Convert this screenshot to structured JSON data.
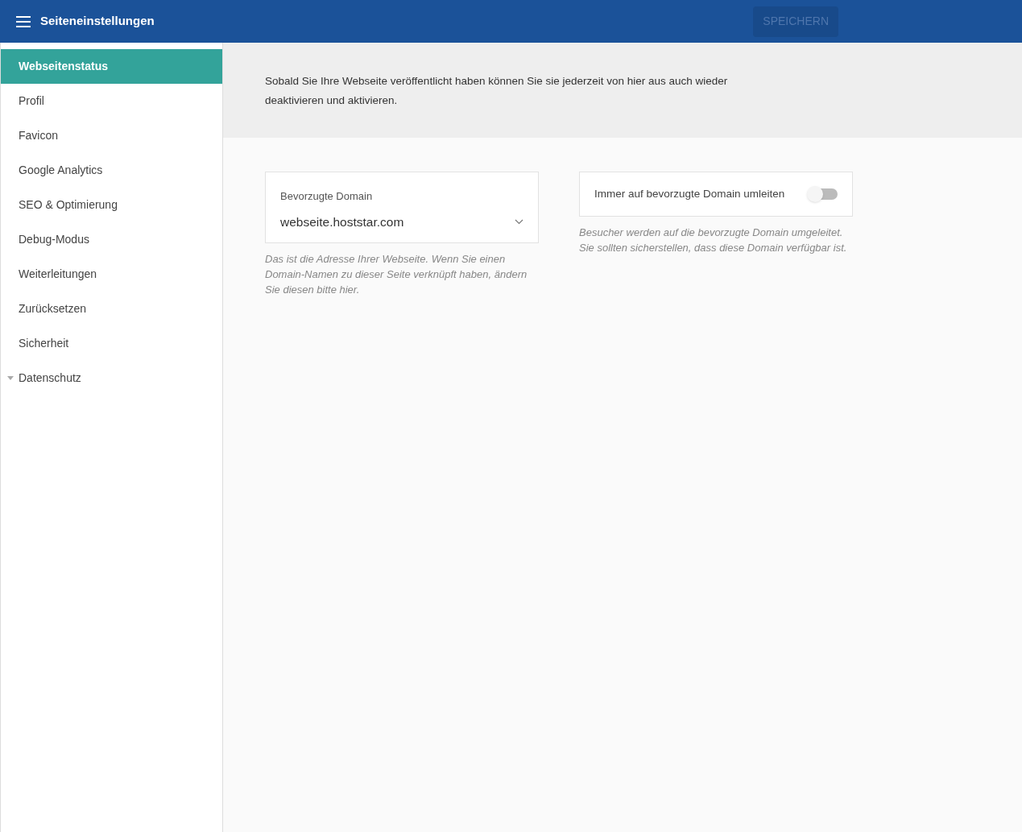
{
  "header": {
    "title": "Seiteneinstellungen",
    "save_button": {
      "label": "SPEICHERN",
      "disabled": true
    }
  },
  "sidebar": {
    "items": [
      {
        "label": "Webseitenstatus",
        "selected": true,
        "kind": "link"
      },
      {
        "label": "Profil",
        "selected": false,
        "kind": "link"
      },
      {
        "label": "Favicon",
        "selected": false,
        "kind": "link"
      },
      {
        "label": "Google Analytics",
        "selected": false,
        "kind": "link"
      },
      {
        "label": "SEO & Optimierung",
        "selected": false,
        "kind": "link"
      },
      {
        "label": "Debug-Modus",
        "selected": false,
        "kind": "link"
      },
      {
        "label": "Weiterleitungen",
        "selected": false,
        "kind": "link"
      },
      {
        "label": "Zurücksetzen",
        "selected": false,
        "kind": "link"
      },
      {
        "label": "Sicherheit",
        "selected": false,
        "kind": "link"
      },
      {
        "label": "Datenschutz",
        "selected": false,
        "kind": "group"
      }
    ]
  },
  "info_banner": "Sobald Sie Ihre Webseite veröffentlicht haben können Sie sie jederzeit von hier aus auch wieder deaktivieren und aktivieren.",
  "domain_select": {
    "label": "Bevorzugte Domain",
    "value": "webseite.hoststar.com",
    "help": "Das ist die Adresse Ihrer Webseite. Wenn Sie einen Domain-Namen zu dieser Seite verknüpft haben, ändern Sie diesen bitte hier."
  },
  "redirect_toggle": {
    "label": "Immer auf bevorzugte Domain umleiten",
    "on": false,
    "help": "Besucher werden auf die bevorzugte Domain umgeleitet. Sie sollten sicherstellen, dass diese Domain verfügbar ist."
  }
}
